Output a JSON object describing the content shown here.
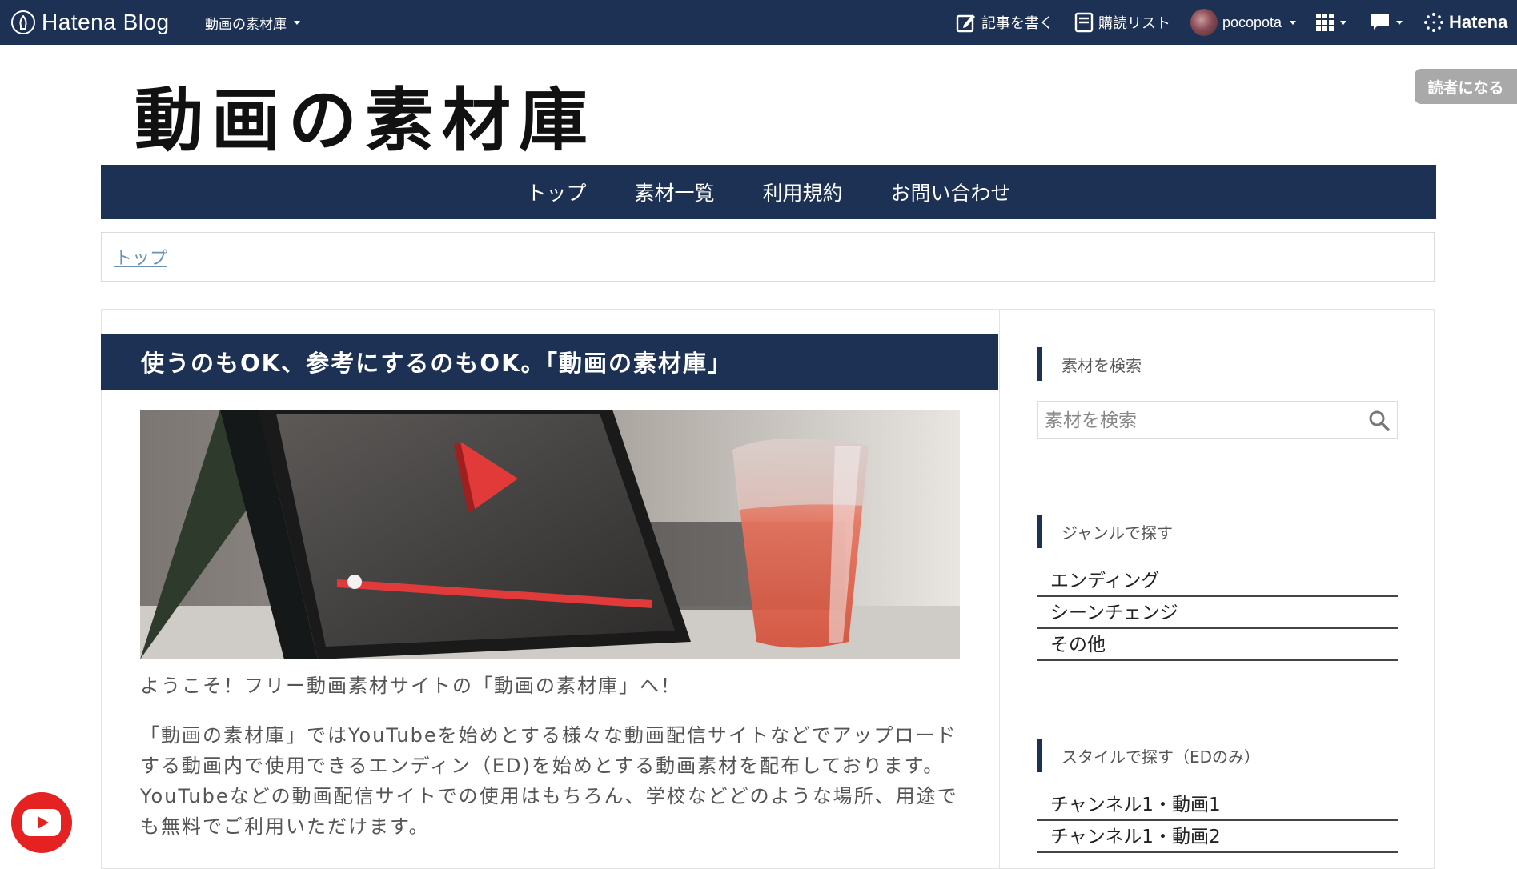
{
  "topbar": {
    "logo_text": "Hatena Blog",
    "blog_menu_label": "動画の素材庫",
    "write_label": "記事を書く",
    "reading_list_label": "購読リスト",
    "username": "pocopota",
    "hatena_label": "Hatena",
    "icons": [
      "hatena-blog-logo-icon",
      "pencil-edit-icon",
      "reading-list-icon",
      "apps-grid-icon",
      "notification-icon",
      "hatena-dots-icon"
    ]
  },
  "blog": {
    "title": "動画の素材庫",
    "subscribe_label": "読者になる"
  },
  "nav": {
    "items": [
      "トップ",
      "素材一覧",
      "利用規約",
      "お問い合わせ"
    ]
  },
  "breadcrumb": {
    "top": "トップ"
  },
  "entry": {
    "title": "使うのもOK、参考にするのもOK。「動画の素材庫」",
    "paragraphs": [
      "ようこそ！フリー動画素材サイトの「動画の素材庫」へ！",
      "「動画の素材庫」ではYouTubeを始めとする様々な動画配信サイトなどでアップロードする動画内で使用できるエンディン（ED)を始めとする動画素材を配布しております。YouTubeなどの動画配信サイトでの使用はもちろん、学校などどのような場所、用途でも無料でご利用いただけます。"
    ]
  },
  "sidebar": {
    "search": {
      "title": "素材を検索",
      "placeholder": "素材を検索"
    },
    "genre": {
      "title": "ジャンルで探す",
      "items": [
        "エンディング",
        "シーンチェンジ",
        "その他"
      ]
    },
    "style": {
      "title": "スタイルで探す（EDのみ）",
      "items": [
        "チャンネル1・動画1",
        "チャンネル1・動画2"
      ]
    }
  },
  "colors": {
    "nav_bg": "#1c3153",
    "subscribe_bg": "#a9a9a9",
    "youtube_red": "#e52121",
    "breadcrumb_link": "#6a93b5"
  }
}
